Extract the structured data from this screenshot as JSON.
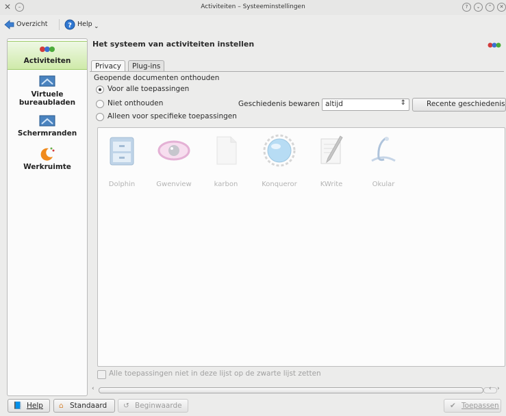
{
  "window": {
    "title": "Activiteiten – Systeeminstellingen"
  },
  "toolbar": {
    "overview_label": "Overzicht",
    "help_label": "Help"
  },
  "sidebar": {
    "items": [
      {
        "label": "Activiteiten",
        "icon": "activities-icon",
        "active": true
      },
      {
        "label": "Virtuele bureaubladen",
        "icon": "virtual-desktops-icon"
      },
      {
        "label": "Schermranden",
        "icon": "screen-edges-icon"
      },
      {
        "label": "Werkruimte",
        "icon": "workspace-icon"
      }
    ]
  },
  "main": {
    "heading": "Het systeem van activiteiten instellen",
    "tabs": [
      {
        "label": "Privacy"
      },
      {
        "label": "Plug-ins"
      }
    ],
    "open_docs_label": "Geopende documenten onthouden",
    "radio_options": [
      {
        "label": "Voor alle toepassingen",
        "selected": true
      },
      {
        "label": "Niet onthouden",
        "selected": false
      },
      {
        "label": "Alleen voor specifieke toepassingen",
        "selected": false
      }
    ],
    "history_label": "Geschiedenis bewaren",
    "history_value": "altijd",
    "clear_history_label": "Recente geschiedenis wi",
    "apps": [
      "Dolphin",
      "Gwenview",
      "karbon",
      "Konqueror",
      "KWrite",
      "Okular"
    ],
    "blacklist_label": "Alle toepassingen niet in deze lijst op de zwarte lijst zetten"
  },
  "footer": {
    "help_label": "Help",
    "default_label": "Standaard",
    "reset_label": "Beginwaarde",
    "apply_label": "Toepassen"
  }
}
